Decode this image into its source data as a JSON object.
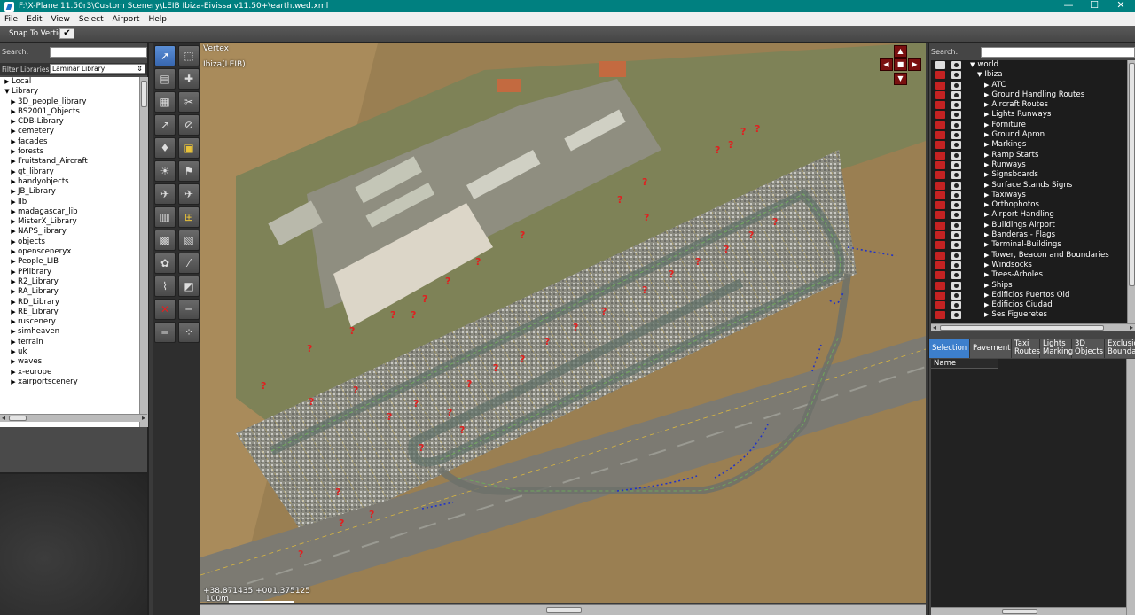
{
  "window": {
    "title": "F:\\X-Plane 11.50r3\\Custom Scenery\\LEIB Ibiza-Eivissa  v11.50+\\earth.wed.xml",
    "minimize": "—",
    "maximize": "☐",
    "close": "✕"
  },
  "menu": [
    "File",
    "Edit",
    "View",
    "Select",
    "Airport",
    "Help"
  ],
  "toolbar": {
    "snap_label": "Snap To Vertices",
    "snap_check": "✔"
  },
  "library": {
    "search_label": "Search:",
    "filter_label": "Filter Libraries:",
    "filter_value": "Laminar Library",
    "roots": [
      {
        "label": "Local",
        "expanded": false
      },
      {
        "label": "Library",
        "expanded": true
      }
    ],
    "items": [
      "3D_people_library",
      "BS2001_Objects",
      "CDB-Library",
      "cemetery",
      "facades",
      "forests",
      "Fruitstand_Aircraft",
      "gt_library",
      "handyobjects",
      "JB_Library",
      "lib",
      "madagascar_lib",
      "MisterX_Library",
      "NAPS_library",
      "objects",
      "opensceneryx",
      "People_LIB",
      "PPlibrary",
      "R2_Library",
      "RA_Library",
      "RD_Library",
      "RE_Library",
      "ruscenery",
      "simheaven",
      "terrain",
      "uk",
      "waves",
      "x-europe",
      "xairportscenery"
    ]
  },
  "map": {
    "tool_name": "Vertex",
    "airport_name": "Ibiza(LEIB)",
    "coordinates": "+38.871435 +001.375125",
    "scale_label": "100m"
  },
  "layers": {
    "search_label": "Search:",
    "root": "world",
    "airport": "Ibiza",
    "groups": [
      "ATC",
      "Ground Handling Routes",
      "Aircraft Routes",
      "Lights Runways",
      "Forniture",
      "Ground Apron",
      "Markings",
      "Ramp Starts",
      "Runways",
      "Signsboards",
      "Surface Stands Signs",
      "Taxiways",
      "Orthophotos",
      "Airport Handling",
      "Buildings Airport",
      "Banderas - Flags",
      "Terminal-Buildings",
      "Tower, Beacon and Boundaries",
      "Windsocks",
      "Trees-Arboles",
      "Ships",
      "Edificios Puertos Old",
      "Edificios Ciudad",
      "Ses Figueretes"
    ]
  },
  "tabs": [
    {
      "label": "Selection",
      "active": true
    },
    {
      "label": "Pavement",
      "active": false
    },
    {
      "label": "Taxi Routes",
      "active": false
    },
    {
      "label": "Lights Marking",
      "active": false
    },
    {
      "label": "3D Objects",
      "active": false
    },
    {
      "label": "Exclusion Boundaries",
      "active": false
    }
  ],
  "properties": {
    "name_header": "Name"
  },
  "colors": {
    "titlebar": "#008080",
    "selected_tab": "#3d7fcc",
    "lock_red": "#c42222",
    "taxiway_yellow": "#d9b640",
    "question_marker": "#e02020",
    "route_blue": "#2033c8"
  }
}
